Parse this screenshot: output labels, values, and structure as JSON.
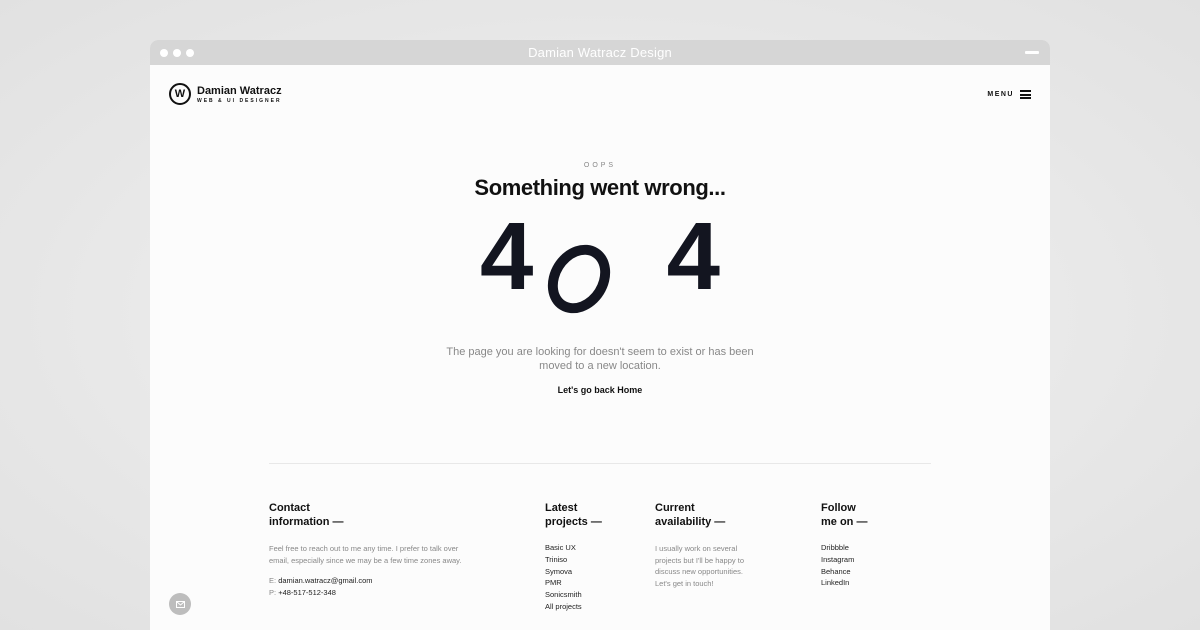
{
  "window": {
    "title": "Damian Watracz Design"
  },
  "header": {
    "logo_letter": "W",
    "brand_name": "Damian Watracz",
    "brand_sub": "WEB & UI DESIGNER",
    "menu_label": "MENU"
  },
  "hero": {
    "eyebrow": "OOPS",
    "headline": "Something went wrong...",
    "code_first": "4",
    "code_last": "4",
    "message": "The page you are looking for doesn't seem to exist or has been moved to a new location.",
    "home_link": "Let's go back Home"
  },
  "footer": {
    "contact": {
      "title_line1": "Contact",
      "title_line2": "information —",
      "text": "Feel free to reach out to me any time. I prefer to talk over email, especially since we may be a few time zones away.",
      "email_prefix": "E:",
      "email": "damian.watracz@gmail.com",
      "phone_prefix": "P:",
      "phone": "+48-517-512-348"
    },
    "projects": {
      "title_line1": "Latest",
      "title_line2": "projects —",
      "items": [
        "Basic UX",
        "Triniso",
        "Symova",
        "PMR",
        "Sonicsmith",
        "All projects"
      ]
    },
    "availability": {
      "title_line1": "Current",
      "title_line2": "availability —",
      "text": "I usually work on several projects but I'll be happy to discuss new opportunities. Let's get in touch!"
    },
    "follow": {
      "title_line1": "Follow",
      "title_line2": "me on —",
      "items": [
        "Dribbble",
        "Instagram",
        "Behance",
        "LinkedIn"
      ]
    }
  },
  "colors": {
    "titlebar": "#d6d6d6",
    "digits": "#131520",
    "chat_button": "#bdbdbd"
  },
  "icons": {
    "chat": "mail-icon",
    "menu": "hamburger-icon"
  }
}
